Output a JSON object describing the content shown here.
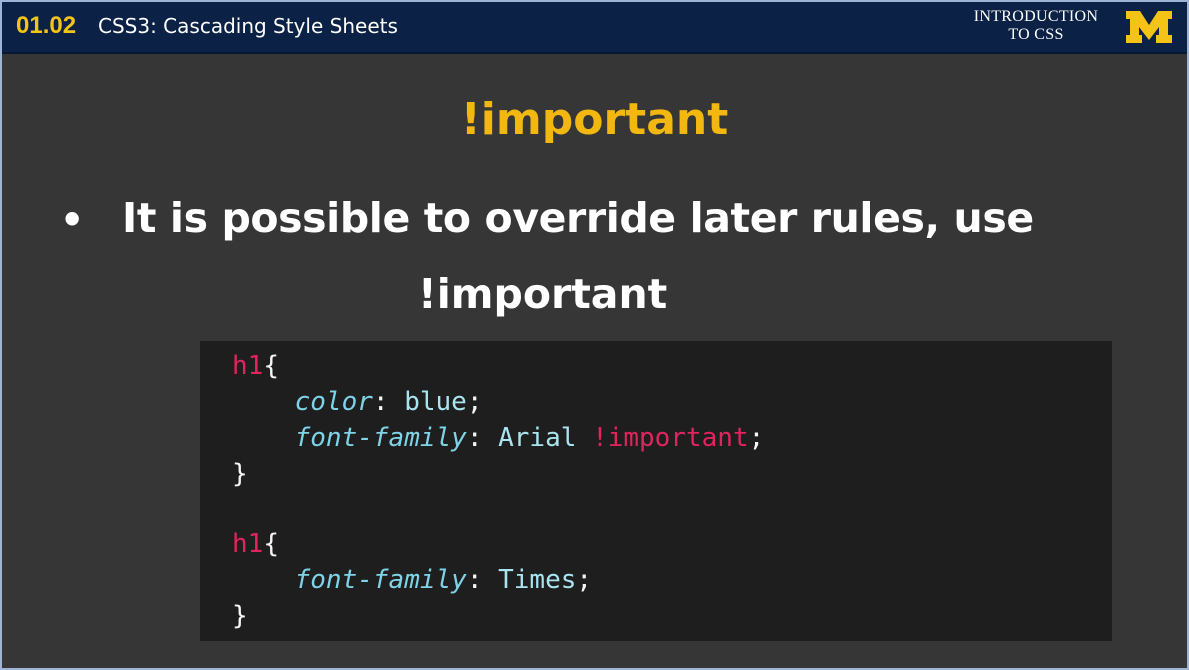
{
  "header": {
    "lesson_number": "01.02",
    "lesson_title": "CSS3: Cascading Style Sheets",
    "course_line1": "INTRODUCTION",
    "course_line2": "TO CSS",
    "logo_letter": "M"
  },
  "slide": {
    "heading": "!important",
    "bullet_symbol": "•",
    "bullet_line1": "It is possible to override later rules, use",
    "bullet_line2": "!important"
  },
  "code": {
    "rule1_selector": "h1",
    "rule1_open": "{",
    "rule1_prop1": "color",
    "rule1_colon1": ":",
    "rule1_val1": "blue",
    "rule1_semi1": ";",
    "rule1_prop2": "font-family",
    "rule1_colon2": ":",
    "rule1_val2": "Arial",
    "rule1_important": "!important",
    "rule1_semi2": ";",
    "rule1_close": "}",
    "rule2_selector": "h1",
    "rule2_open": "{",
    "rule2_prop1": "font-family",
    "rule2_colon1": ":",
    "rule2_val1": "Times",
    "rule2_semi1": ";",
    "rule2_close": "}"
  },
  "colors": {
    "header_bg": "#0b2246",
    "accent_maize": "#f3b80f",
    "slide_bg": "#363636",
    "code_bg": "#1e1e1e",
    "selector": "#e0245e",
    "property": "#7fd3e6",
    "value": "#a9e4f0"
  }
}
